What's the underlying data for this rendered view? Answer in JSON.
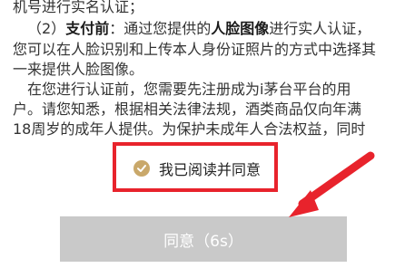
{
  "agreement": {
    "lines": [
      {
        "text": "机号进行实名认证；"
      },
      {
        "prefix": "（2）",
        "bold": "支付前",
        "text": "：通过您提供的",
        "bold2": "人脸图像",
        "suffix": "进行实人认证，"
      },
      {
        "text": "您可以在人脸识别和上传本人身份证照片的方式中选择其"
      },
      {
        "text": "一来提供人脸图像。"
      },
      {
        "text": "在您进行认证前，您需要先注册成为i茅台平台的用"
      },
      {
        "text": "户。请您知悉，根据相关法律法规，酒类商品仅向年满"
      },
      {
        "text": "18周岁的成年人提供。为保护未成年人合法权益，同时"
      }
    ]
  },
  "consent": {
    "label": "我已阅读并同意",
    "checked": true
  },
  "agree_button": {
    "label": "同意（6s）"
  },
  "colors": {
    "highlight": "#e8232c",
    "check": "#c9a86a",
    "button_bg": "#c9c9c9"
  },
  "annotation": {
    "arrow_icon": "red-arrow-icon"
  }
}
